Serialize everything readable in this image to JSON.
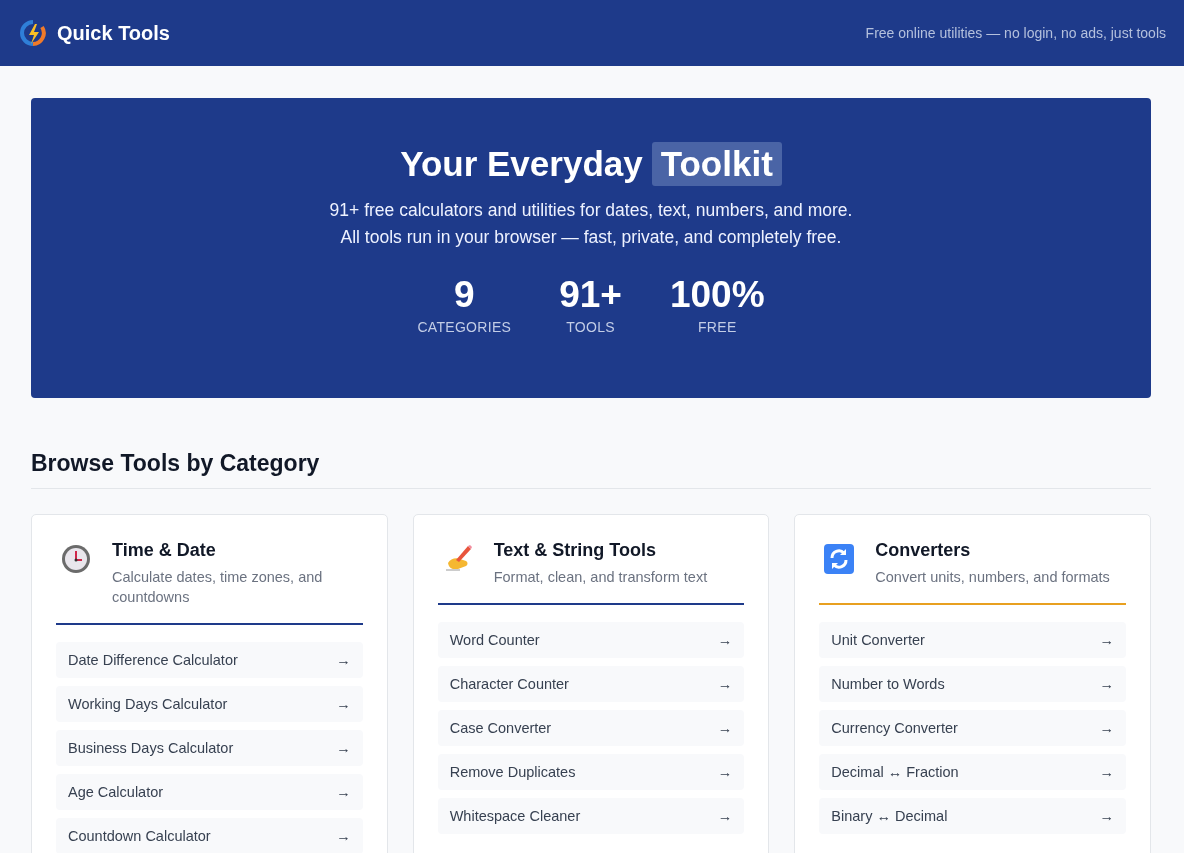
{
  "header": {
    "brand": "Quick Tools",
    "tagline": "Free online utilities — no login, no ads, just tools"
  },
  "hero": {
    "title_prefix": "Your Everyday",
    "title_highlight": "Toolkit",
    "lines": [
      "91+ free calculators and utilities for dates, text, numbers, and more.",
      "All tools run in your browser — fast, private, and completely free."
    ],
    "stats": [
      {
        "value": "9",
        "label": "CATEGORIES"
      },
      {
        "value": "91+",
        "label": "TOOLS"
      },
      {
        "value": "100%",
        "label": "FREE"
      }
    ]
  },
  "section_title": "Browse Tools by Category",
  "categories": [
    {
      "kind": "time",
      "title": "Time & Date",
      "description": "Calculate dates, time zones, and countdowns",
      "color": "#1e3a8a",
      "tools": [
        "Date Difference Calculator",
        "Working Days Calculator",
        "Business Days Calculator",
        "Age Calculator",
        "Countdown Calculator"
      ]
    },
    {
      "kind": "text",
      "title": "Text & String Tools",
      "description": "Format, clean, and transform text",
      "color": "#1e3a8a",
      "tools": [
        "Word Counter",
        "Character Counter",
        "Case Converter",
        "Remove Duplicates",
        "Whitespace Cleaner"
      ]
    },
    {
      "kind": "converter",
      "title": "Converters",
      "description": "Convert units, numbers, and formats",
      "color": "#e8a020",
      "tools": [
        "Unit Converter",
        "Number to Words",
        "Currency Converter",
        "Decimal ↔ Fraction",
        "Binary ↔ Decimal"
      ]
    }
  ],
  "arrow": "→"
}
